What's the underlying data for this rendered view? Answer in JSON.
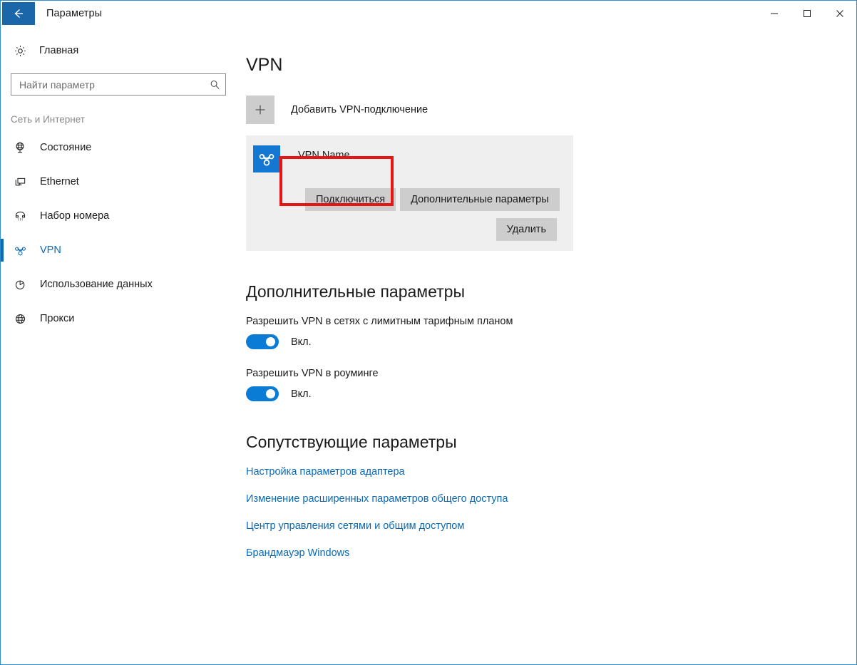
{
  "window": {
    "title": "Параметры",
    "back_icon": "back-arrow-icon",
    "minimize_label": "—",
    "maximize_label": "□",
    "close_label": "✕",
    "accent_color": "#0a6ab6",
    "titlebar_button_color": "#1a66a8"
  },
  "sidebar": {
    "home": {
      "label": "Главная",
      "icon": "gear-icon"
    },
    "search": {
      "placeholder": "Найти параметр",
      "value": "",
      "icon": "search-icon"
    },
    "group_title": "Сеть и Интернет",
    "items": [
      {
        "label": "Состояние",
        "icon": "globe-stand-icon",
        "selected": false
      },
      {
        "label": "Ethernet",
        "icon": "ethernet-monitor-icon",
        "selected": false
      },
      {
        "label": "Набор номера",
        "icon": "telephone-icon",
        "selected": false
      },
      {
        "label": "VPN",
        "icon": "vpn-knot-icon",
        "selected": true
      },
      {
        "label": "Использование данных",
        "icon": "pie-chart-icon",
        "selected": false
      },
      {
        "label": "Прокси",
        "icon": "globe-icon",
        "selected": false
      }
    ]
  },
  "main": {
    "page_title": "VPN",
    "add_connection": {
      "label": "Добавить VPN-подключение",
      "icon": "plus-icon"
    },
    "vpn_card": {
      "name": "VPN Name",
      "icon": "vpn-knot-icon",
      "connect_label": "Подключиться",
      "advanced_label": "Дополнительные параметры",
      "delete_label": "Удалить",
      "highlight_color": "#e81515"
    },
    "advanced_section": {
      "title": "Дополнительные параметры",
      "settings": [
        {
          "label": "Разрешить VPN в сетях с лимитным тарифным планом",
          "state": "Вкл.",
          "on": true
        },
        {
          "label": "Разрешить VPN в роуминге",
          "state": "Вкл.",
          "on": true
        }
      ]
    },
    "related_section": {
      "title": "Сопутствующие параметры",
      "links": [
        "Настройка параметров адаптера",
        "Изменение расширенных параметров общего доступа",
        "Центр управления сетями и общим доступом",
        "Брандмауэр Windows"
      ]
    }
  }
}
